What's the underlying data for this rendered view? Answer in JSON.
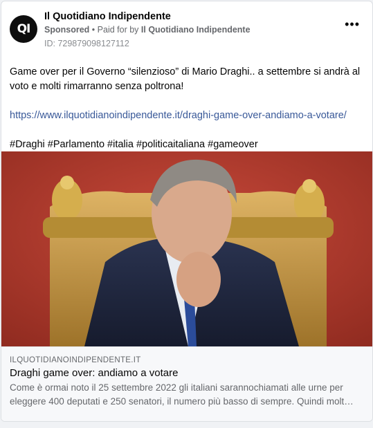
{
  "post": {
    "page_name": "Il Quotidiano Indipendente",
    "logo_text": "QI",
    "sponsored_label": "Sponsored",
    "separator": "•",
    "paid_prefix": "Paid for by",
    "payer_name": "Il Quotidiano Indipendente",
    "ad_id": "ID: 729879098127112",
    "more_icon": "more-horizontal-icon",
    "text_line1": "Game over per il Governo “silenzioso” di Mario Draghi.. a settembre si andrà al voto e molti rimarranno senza poltrona!",
    "url": "https://www.ilquotidianoindipendente.it/draghi-game-over-andiamo-a-votare/",
    "hashtags": "#Draghi #Parlamento #italia #politicaitaliana #gameover"
  },
  "link_preview": {
    "domain": "ILQUOTIDIANOINDIPENDENTE.IT",
    "headline": "Draghi game over: andiamo a votare",
    "description_line1": "Come è ormai noto il 25 settembre 2022 gli italiani sarannochiamati alle urne per",
    "description_line2": "eleggere 400 deputati e 250 senatori, il numero più basso di sempre. Quindi molt…"
  },
  "colors": {
    "link": "#385898",
    "background": "#ffffff",
    "muted_text": "#65676b",
    "photo_backdrop": "#b53a2b",
    "chair_gold": "#c9a23d"
  }
}
